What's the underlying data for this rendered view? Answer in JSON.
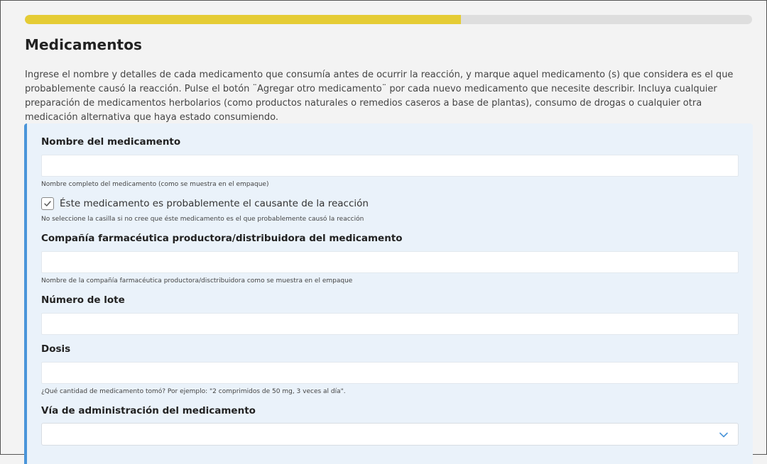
{
  "progress": {
    "fraction": 0.6,
    "fill_color": "#e5cc35",
    "track_color": "#dedede"
  },
  "section": {
    "title": "Medicamentos",
    "description": "Ingrese el nombre y detalles de cada medicamento que consumía antes de ocurrir la reacción, y marque aquel medicamento (s) que considera es el que probablemente causó la reacción. Pulse el botón ¨Agregar otro medicamento¨ por cada nuevo medicamento que necesite describir. Incluya cualquier preparación de medicamentos herbolarios (como productos naturales o remedios caseros a base de plantas), consumo de drogas o cualquier otra medicación alternativa que haya estado consumiendo."
  },
  "form": {
    "accent_color": "#4a95d9",
    "card_background": "#eaf2fa",
    "medication_name": {
      "label": "Nombre del medicamento",
      "value": "",
      "help": "Nombre completo del medicamento (como se muestra en el empaque)"
    },
    "suspect": {
      "label": "Éste medicamento es probablemente el causante de la reacción",
      "checked": true,
      "check_icon": "check-icon",
      "help": "No seleccione la casilla si no cree que éste medicamento es el que probablemente causó la reacción"
    },
    "manufacturer": {
      "label": "Compañía farmacéutica productora/distribuidora del medicamento",
      "value": "",
      "help": "Nombre de la compañía farmacéutica productora/disctribuidora como se muestra en el empaque"
    },
    "lot_number": {
      "label": "Número de lote",
      "value": ""
    },
    "dose": {
      "label": "Dosis",
      "value": "",
      "help": "¿Qué cantidad de medicamento tomó? Por ejemplo: \"2 comprimidos de 50 mg, 3 veces al día\"."
    },
    "route": {
      "label": "Vía de administración del medicamento",
      "selected": "",
      "chevron_icon": "chevron-down-icon",
      "chevron_color": "#4a95d9"
    }
  }
}
